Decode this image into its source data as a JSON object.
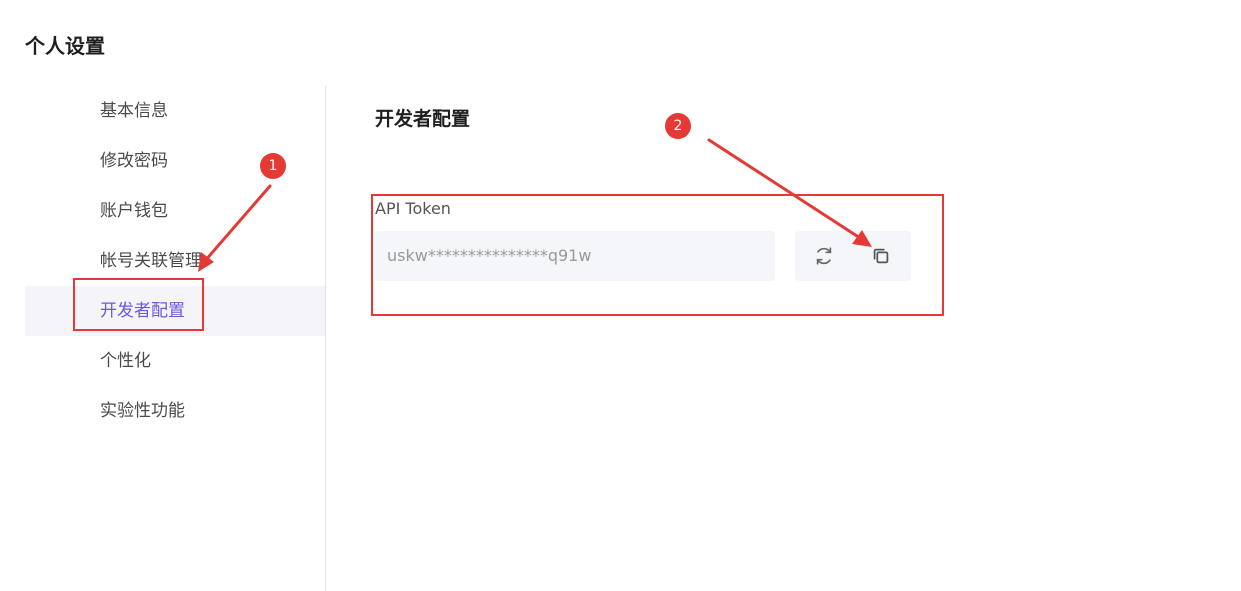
{
  "page": {
    "title": "个人设置"
  },
  "sidebar": {
    "items": [
      {
        "label": "基本信息"
      },
      {
        "label": "修改密码"
      },
      {
        "label": "账户钱包"
      },
      {
        "label": "帐号关联管理"
      },
      {
        "label": "开发者配置",
        "active": true
      },
      {
        "label": "个性化"
      },
      {
        "label": "实验性功能"
      }
    ]
  },
  "main": {
    "section_title": "开发者配置",
    "api_token": {
      "label": "API Token",
      "value": "uskw***************q91w",
      "actions": [
        {
          "icon": "refresh-icon"
        },
        {
          "icon": "copy-icon"
        }
      ]
    }
  },
  "annotations": {
    "markers": [
      "1",
      "2"
    ],
    "color": "#e53935"
  },
  "colors": {
    "accent": "#6a5ae0",
    "annotation": "#e53935",
    "field_background": "#f5f6f9"
  }
}
